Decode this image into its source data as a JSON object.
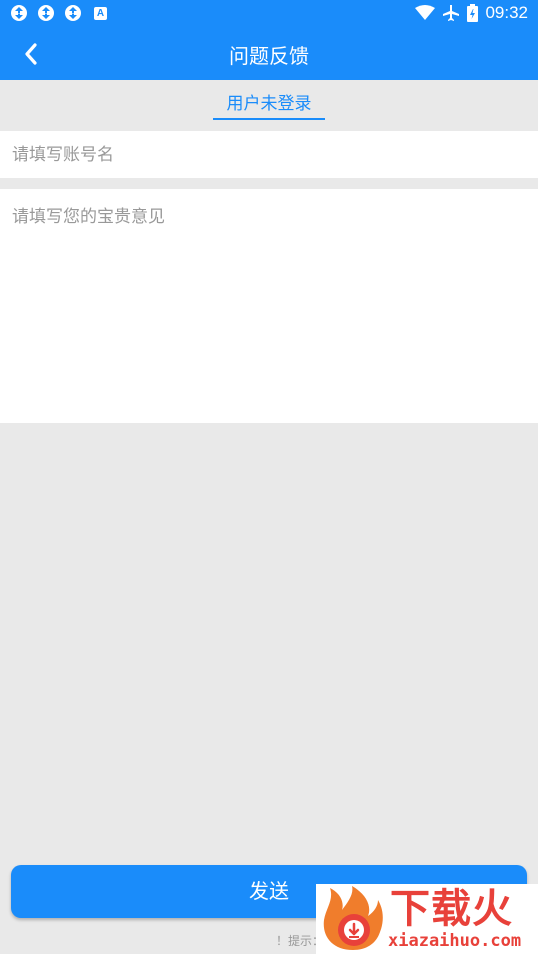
{
  "status_bar": {
    "notification_icons": [
      "sync-icon",
      "sync-icon",
      "sync-icon"
    ],
    "a_badge": "A",
    "time": "09:32",
    "icons": [
      "wifi-icon",
      "airplane-icon",
      "battery-icon"
    ]
  },
  "header": {
    "title": "问题反馈",
    "back_icon": "chevron-left-icon"
  },
  "login_status": "用户未登录",
  "form": {
    "account_placeholder": "请填写账号名",
    "account_value": "",
    "feedback_placeholder": "请填写您的宝贵意见",
    "feedback_value": ""
  },
  "send_button": "发送",
  "hint": "！提示：",
  "watermark": {
    "brand": "下载火",
    "url": "xiazaihuo.com"
  },
  "colors": {
    "primary": "#1a8cfa",
    "background": "#e9e9e9",
    "watermark_red": "#e8413a"
  }
}
